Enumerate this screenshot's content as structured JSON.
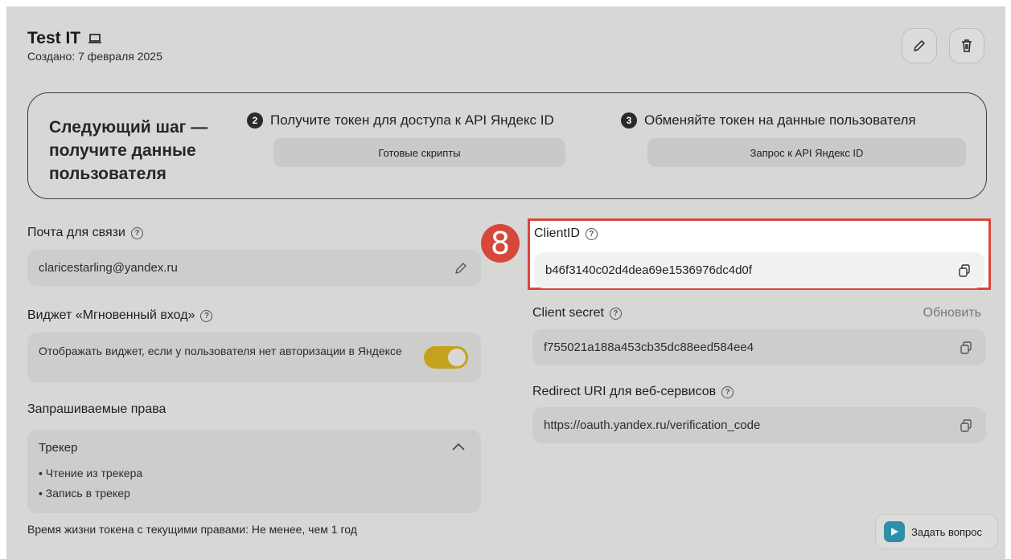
{
  "header": {
    "app_title": "Test IT",
    "created": "Создано: 7 февраля 2025"
  },
  "next_step": {
    "title": "Следующий шаг — получите данные пользователя",
    "step2": {
      "num": "2",
      "text": "Получите токен для доступа к API Яндекс ID",
      "button": "Готовые скрипты"
    },
    "step3": {
      "num": "3",
      "text": "Обменяйте токен на данные пользователя",
      "button": "Запрос к API Яндекс ID"
    }
  },
  "contact": {
    "label": "Почта для связи",
    "value": "claricestarling@yandex.ru"
  },
  "widget": {
    "label": "Виджет «Мгновенный вход»",
    "description": "Отображать виджет, если у пользователя нет авторизации в Яндексе",
    "enabled": true
  },
  "rights": {
    "label": "Запрашиваемые права",
    "group": "Трекер",
    "items": [
      "• Чтение из трекера",
      "• Запись в трекер"
    ],
    "lifetime": "Время жизни токена с текущими правами: Не менее, чем 1 год"
  },
  "client_id": {
    "label": "ClientID",
    "value": "b46f3140c02d4dea69e1536976dc4d0f",
    "badge": "8"
  },
  "client_secret": {
    "label": "Client secret",
    "refresh": "Обновить",
    "value": "f755021a188a453cb35dc88eed584ee4"
  },
  "redirect": {
    "label": "Redirect URI для веб-сервисов",
    "value": "https://oauth.yandex.ru/verification_code"
  },
  "help_glyph": "?",
  "ask": {
    "label": "Задать вопрос"
  },
  "colors": {
    "accent": "#d6483a",
    "toggle": "#c5a21d",
    "overlay": "#d7d7d6"
  }
}
